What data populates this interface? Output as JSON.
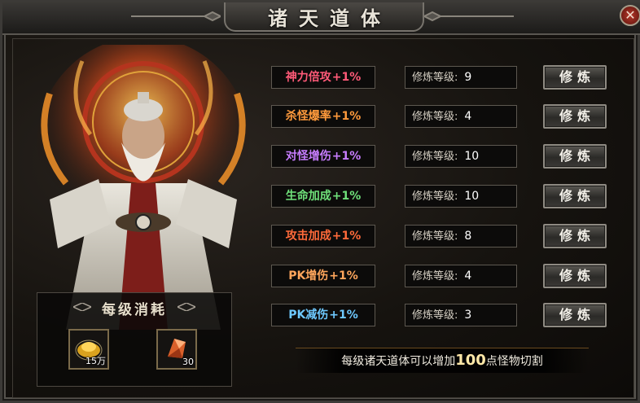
{
  "window": {
    "title": "诸天道体",
    "close_symbol": "✕"
  },
  "cost": {
    "title": "每级消耗",
    "items": [
      {
        "name": "gold-ingot",
        "qty": "15万"
      },
      {
        "name": "crystal-shard",
        "qty": "30"
      }
    ]
  },
  "rows": [
    {
      "attribute": "神力倍攻",
      "bonus": "+1%",
      "color": "#ff5a78",
      "level_label": "修炼等级:",
      "level": "9",
      "button": "修炼"
    },
    {
      "attribute": "杀怪爆率",
      "bonus": "+1%",
      "color": "#ff9a3c",
      "level_label": "修炼等级:",
      "level": "4",
      "button": "修炼"
    },
    {
      "attribute": "对怪增伤",
      "bonus": "+1%",
      "color": "#c77dff",
      "level_label": "修炼等级:",
      "level": "10",
      "button": "修炼"
    },
    {
      "attribute": "生命加成",
      "bonus": "+1%",
      "color": "#6fe07a",
      "level_label": "修炼等级:",
      "level": "10",
      "button": "修炼"
    },
    {
      "attribute": "攻击加成",
      "bonus": "+1%",
      "color": "#ff6a3a",
      "level_label": "修炼等级:",
      "level": "8",
      "button": "修炼"
    },
    {
      "attribute": "PK增伤",
      "bonus": "+1%",
      "color": "#ffa65c",
      "level_label": "修炼等级:",
      "level": "4",
      "button": "修炼"
    },
    {
      "attribute": "PK减伤",
      "bonus": "+1%",
      "color": "#6ec9ff",
      "level_label": "修炼等级:",
      "level": "3",
      "button": "修炼"
    }
  ],
  "info": {
    "prefix": "每级诸天道体可以增加",
    "number": "100",
    "suffix": "点怪物切割"
  },
  "colors": {
    "bonus": "#f5e9c8",
    "accent_gold": "#c99a3a"
  }
}
